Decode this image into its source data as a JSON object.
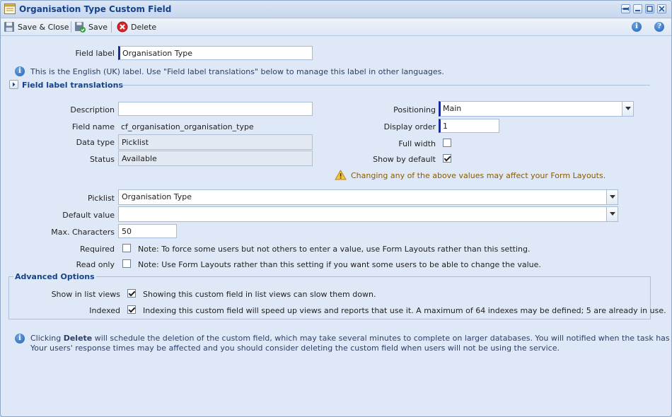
{
  "window": {
    "title": "Organisation Type Custom Field",
    "controls": [
      "pin-icon",
      "minimize-icon",
      "maximize-icon",
      "close-icon"
    ]
  },
  "toolbar": {
    "save_close_label": "Save & Close",
    "save_label": "Save",
    "delete_label": "Delete"
  },
  "form": {
    "field_label_label": "Field label",
    "field_label_value": "Organisation Type",
    "field_label_note": "This is the English (UK) label. Use \"Field label translations\" below to manage this label in other languages.",
    "translations_heading": "Field label translations",
    "description_label": "Description",
    "description_value": "",
    "field_name_label": "Field name",
    "field_name_value": "cf_organisation_organisation_type",
    "data_type_label": "Data type",
    "data_type_value": "Picklist",
    "status_label": "Status",
    "status_value": "Available",
    "positioning_label": "Positioning",
    "positioning_value": "Main",
    "display_order_label": "Display order",
    "display_order_value": "1",
    "full_width_label": "Full width",
    "full_width_checked": false,
    "show_by_default_label": "Show by default",
    "show_by_default_checked": true,
    "layout_warning": "Changing any of the above values may affect your Form Layouts.",
    "picklist_label": "Picklist",
    "picklist_value": "Organisation Type",
    "default_value_label": "Default value",
    "default_value_value": "",
    "max_chars_label": "Max. Characters",
    "max_chars_value": "50",
    "required_label": "Required",
    "required_checked": false,
    "required_note": "Note: To force some users but not others to enter a value, use Form Layouts rather than this setting.",
    "read_only_label": "Read only",
    "read_only_checked": false,
    "read_only_note": "Note: Use Form Layouts rather than this setting if you want some users to be able to change the value."
  },
  "advanced": {
    "heading": "Advanced Options",
    "show_in_list_label": "Show in list views",
    "show_in_list_checked": true,
    "show_in_list_note": "Showing this custom field in list views can slow them down.",
    "indexed_label": "Indexed",
    "indexed_checked": true,
    "indexed_note": "Indexing this custom field will speed up views and reports that use it. A maximum of 64 indexes may be defined; 5 are already in use."
  },
  "footer": {
    "note_prefix": "Clicking ",
    "note_bold": "Delete",
    "note_line1_rest": " will schedule the deletion of the custom field, which may take several minutes to complete on larger databases. You will notified when the task has completed.",
    "note_line2": "Your users' response times may be affected and you should consider deleting the custom field when users will not be using the service."
  }
}
